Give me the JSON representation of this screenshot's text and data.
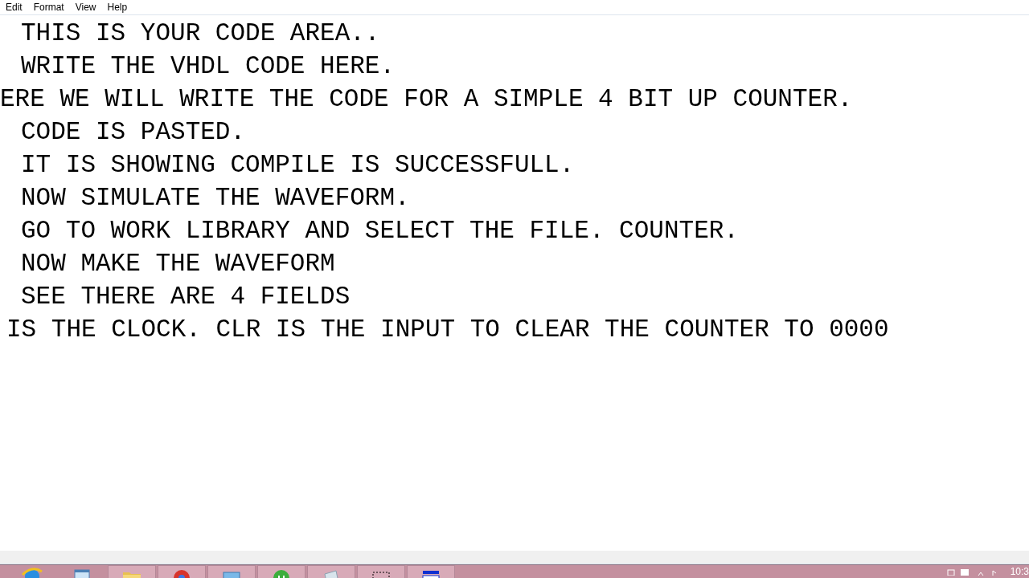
{
  "menu": [
    {
      "label": "Edit"
    },
    {
      "label": "Format"
    },
    {
      "label": "View"
    },
    {
      "label": "Help"
    }
  ],
  "editor": {
    "lines": [
      "THIS IS YOUR CODE AREA..",
      "WRITE THE VHDL CODE HERE.",
      "ERE WE WILL WRITE THE CODE FOR A SIMPLE 4 BIT UP COUNTER.",
      "CODE IS PASTED.",
      "IT IS SHOWING COMPILE IS SUCCESSFULL.",
      "NOW SIMULATE THE WAVEFORM.",
      "GO TO WORK LIBRARY AND SELECT THE FILE. COUNTER.",
      "NOW MAKE THE WAVEFORM",
      "SEE THERE ARE 4 FIELDS",
      "IS THE CLOCK. CLR IS THE INPUT TO CLEAR THE COUNTER TO 0000"
    ]
  },
  "taskbar": {
    "apps": [
      {
        "kind": "browser",
        "open": false
      },
      {
        "kind": "window",
        "open": false
      },
      {
        "kind": "folder",
        "open": true
      },
      {
        "kind": "chrome",
        "open": true
      },
      {
        "kind": "monitor",
        "open": true
      },
      {
        "kind": "green",
        "open": true
      },
      {
        "kind": "notepad",
        "open": true
      },
      {
        "kind": "snip",
        "open": true
      },
      {
        "kind": "blue",
        "open": true
      }
    ],
    "clock": "10:3"
  }
}
